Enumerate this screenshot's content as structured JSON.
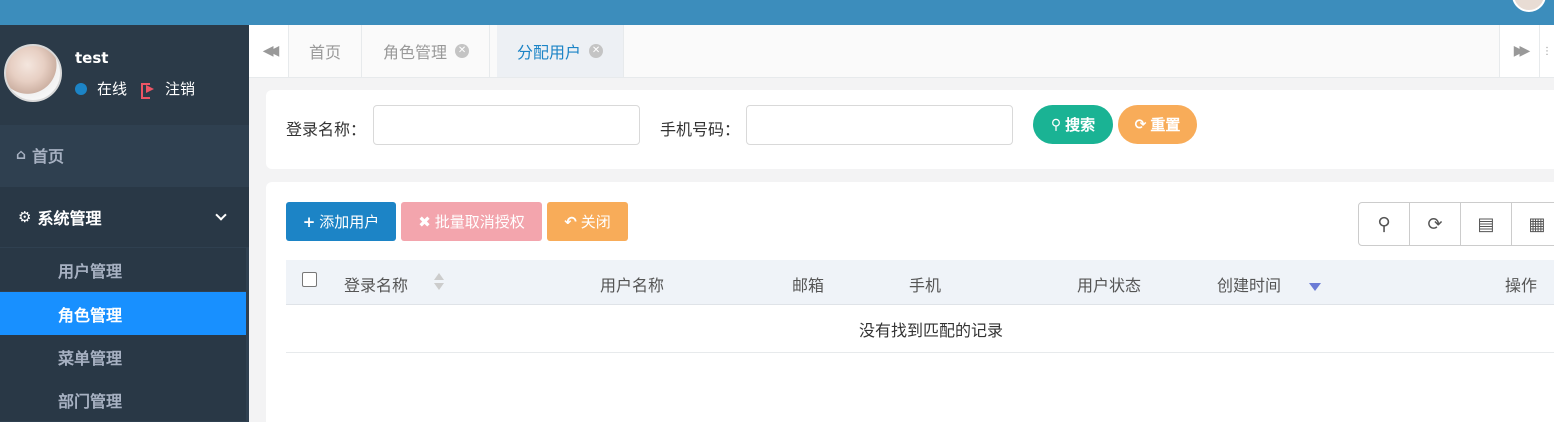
{
  "topbar": {
    "brand_fragment": "",
    "accent": "#3c8dbc"
  },
  "user": {
    "name": "test",
    "status": "在线",
    "logout": "注销"
  },
  "nav": {
    "home": "首页",
    "system": "系统管理",
    "sub_items": [
      {
        "label": "用户管理",
        "active": false
      },
      {
        "label": "角色管理",
        "active": true
      },
      {
        "label": "菜单管理",
        "active": false
      },
      {
        "label": "部门管理",
        "active": false
      }
    ]
  },
  "tabs": [
    {
      "label": "首页",
      "closable": false,
      "active": false
    },
    {
      "label": "角色管理",
      "closable": true,
      "active": false
    },
    {
      "label": "分配用户",
      "closable": true,
      "active": true
    }
  ],
  "search": {
    "login_name_label": "登录名称：",
    "login_name_value": "",
    "phone_label": "手机号码：",
    "phone_value": "",
    "search_button": "搜索",
    "reset_button": "重置"
  },
  "toolbar": {
    "add_user": "添加用户",
    "batch_revoke": "批量取消授权",
    "close": "关闭",
    "tools": [
      "search-icon",
      "refresh-icon",
      "columns-icon",
      "grid-icon"
    ]
  },
  "table": {
    "columns": [
      "登录名称",
      "用户名称",
      "邮箱",
      "手机",
      "用户状态",
      "创建时间",
      "操作"
    ],
    "empty_text": "没有找到匹配的记录"
  },
  "colors": {
    "sidebar": "#2f4050",
    "active_nav": "#1890ff",
    "primary": "#1c84c6",
    "success": "#1ab394",
    "warning": "#f8ac59",
    "danger_light": "#f3a5ad"
  }
}
